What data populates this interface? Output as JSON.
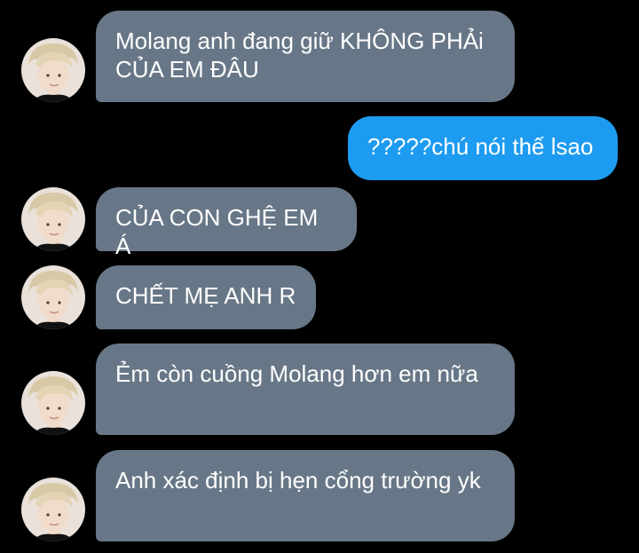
{
  "conversation": {
    "messages": [
      {
        "sender": "them",
        "text": "Molang anh đang giữ KHÔNG PHẢi CỦA EM ĐÂU"
      },
      {
        "sender": "me",
        "text": "?????chú nói thế lsao"
      },
      {
        "sender": "them",
        "text": "CỦA CON GHỆ EM Á"
      },
      {
        "sender": "them",
        "text": "CHẾT MẸ ANH R"
      },
      {
        "sender": "them",
        "text": "Ẻm còn cuồng Molang hơn em nữa"
      },
      {
        "sender": "them",
        "text": "Anh xác định bị hẹn cổng trường yk"
      }
    ]
  },
  "colors": {
    "background": "#000000",
    "incoming_bubble": "#687787",
    "outgoing_bubble": "#1d9bf0",
    "text": "#ffffff"
  },
  "icons": {
    "avatar": "avatar-photo"
  }
}
